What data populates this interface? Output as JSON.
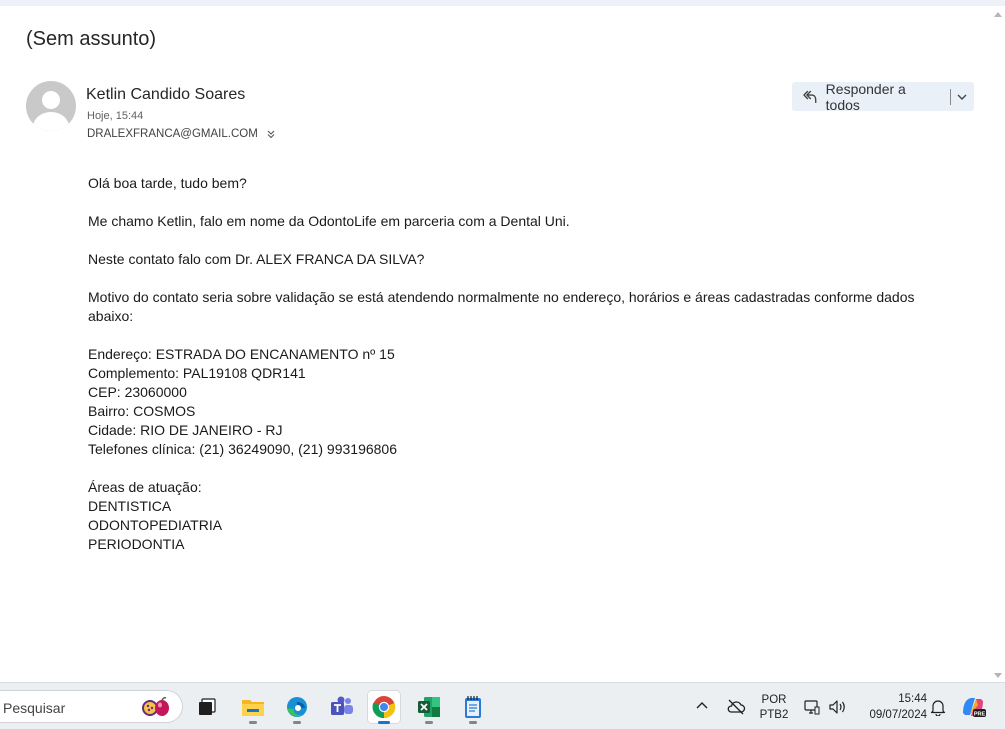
{
  "message": {
    "subject": "(Sem assunto)",
    "sender_name": "Ketlin Candido Soares",
    "sent_time": "Hoje, 15:44",
    "recipient": "DRALEXFRANCA@GMAIL.COM",
    "reply_all_label": "Responder a todos"
  },
  "body_paragraphs": [
    {
      "lines": [
        "Olá boa tarde, tudo bem?"
      ]
    },
    {
      "lines": [
        "Me chamo Ketlin, falo em nome da OdontoLife em parceria com a Dental Uni."
      ]
    },
    {
      "lines": [
        "Neste contato falo com Dr. ALEX FRANCA DA SILVA?"
      ]
    },
    {
      "lines": [
        "Motivo do contato seria sobre validação se está atendendo normalmente no endereço, horários e áreas cadastradas conforme dados",
        "abaixo:"
      ]
    },
    {
      "lines": [
        "Endereço: ESTRADA DO ENCANAMENTO nº 15",
        "Complemento: PAL19108 QDR141",
        "CEP: 23060000",
        "Bairro: COSMOS",
        "Cidade: RIO DE JANEIRO - RJ",
        "Telefones clínica: (21) 36249090, (21) 993196806"
      ]
    },
    {
      "lines": [
        "Áreas de atuação:",
        "DENTISTICA",
        "ODONTOPEDIATRIA",
        "PERIODONTIA"
      ]
    }
  ],
  "taskbar": {
    "search_placeholder": "Pesquisar",
    "apps": [
      {
        "name": "task-view-icon",
        "running": false,
        "active": false
      },
      {
        "name": "file-explorer-icon",
        "running": true,
        "active": false
      },
      {
        "name": "edge-icon",
        "running": true,
        "active": false
      },
      {
        "name": "teams-icon",
        "running": false,
        "active": false
      },
      {
        "name": "chrome-icon",
        "running": true,
        "active": true
      },
      {
        "name": "excel-icon",
        "running": true,
        "active": false
      },
      {
        "name": "notepad-icon",
        "running": true,
        "active": false
      }
    ],
    "language_line1": "POR",
    "language_line2": "PTB2",
    "clock_time": "15:44",
    "clock_date": "09/07/2024"
  },
  "colors": {
    "reply_button_bg": "#eaf0f7",
    "avatar_bg": "#c9c9c9",
    "taskbar_bg": "#eceff2",
    "active_indicator": "#1a73c9"
  }
}
